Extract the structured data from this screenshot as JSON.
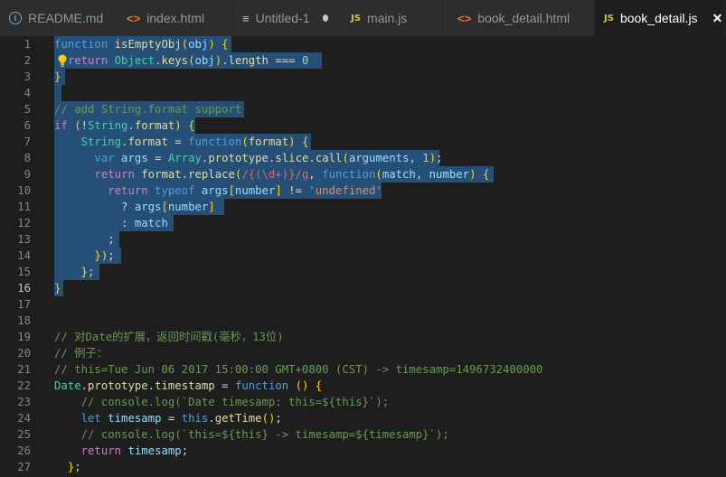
{
  "tabs": [
    {
      "label": "README.md",
      "icon": "info-icon",
      "active": false
    },
    {
      "label": "index.html",
      "icon": "html-code-icon",
      "active": false
    },
    {
      "label": "Untitled-1",
      "icon": "text-lines-icon",
      "active": false,
      "dirty": true
    },
    {
      "label": "main.js",
      "icon": "js-icon",
      "active": false,
      "icon_text": "JS"
    },
    {
      "label": "book_detail.html",
      "icon": "html-code-icon",
      "active": false
    },
    {
      "label": "book_detail.js",
      "icon": "js-icon",
      "active": true,
      "icon_text": "JS"
    }
  ],
  "editor": {
    "current_line": 16,
    "line_numbers": [
      "1",
      "2",
      "3",
      "4",
      "5",
      "6",
      "7",
      "8",
      "9",
      "10",
      "11",
      "12",
      "13",
      "14",
      "15",
      "16",
      "17",
      "18",
      "19",
      "20",
      "21",
      "22",
      "23",
      "24",
      "25",
      "26",
      "27"
    ],
    "lines": [
      "function isEmptyObj(obj) {",
      "  return Object.keys(obj).length === 0",
      "}",
      "",
      "// add String.format support",
      "if (!String.format) {",
      "    String.format = function(format) {",
      "      var args = Array.prototype.slice.call(arguments, 1);",
      "      return format.replace(/{(\\d+)}/g, function(match, number) {",
      "        return typeof args[number] != 'undefined'",
      "          ? args[number]",
      "          : match",
      "        ;",
      "      });",
      "    };",
      "}",
      "",
      "",
      "// 对Date的扩展，返回时间戳(毫秒，13位)",
      "// 例子：",
      "// this=Tue Jun 06 2017 15:00:00 GMT+0800 (CST) -> timesamp=1496732400000",
      "Date.prototype.timestamp = function () {",
      "    // console.log(`Date timesamp: this=${this}`);",
      "    let timesamp = this.getTime();",
      "    // console.log(`this=${this} -> timesamp=${timesamp}`);",
      "    return timesamp;",
      "  };"
    ]
  },
  "colors": {
    "editor_bg": "#1e1e1e",
    "selection": "#264f78",
    "keyword": "#569cd6",
    "control": "#c586c0",
    "function": "#dcdcaa",
    "variable": "#9cdcfe",
    "type": "#4ec9b0",
    "string": "#ce9178",
    "number": "#b5cea8",
    "comment": "#6a9955"
  }
}
